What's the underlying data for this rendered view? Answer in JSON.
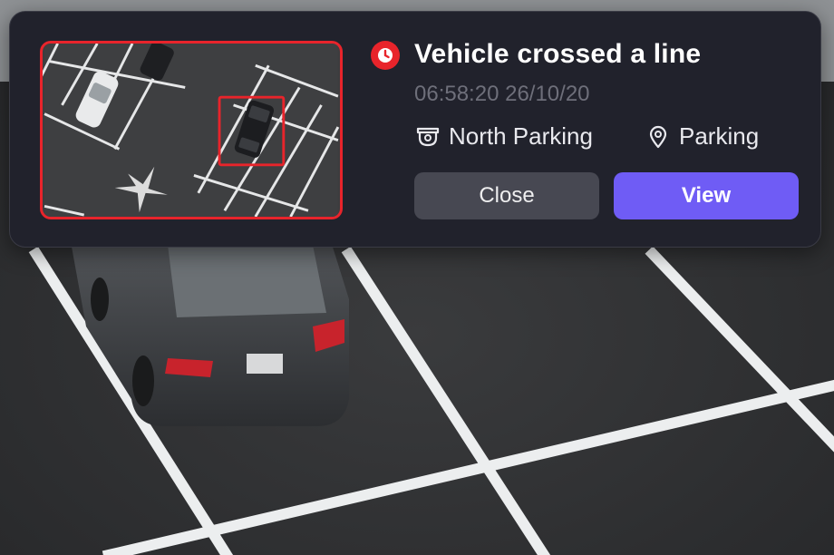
{
  "notification": {
    "event_icon": "alert-clock-icon",
    "title": "Vehicle crossed a line",
    "timestamp": "06:58:20 26/10/20",
    "camera": {
      "icon": "camera-icon",
      "name": "North Parking"
    },
    "location": {
      "icon": "location-pin-icon",
      "name": "Parking"
    },
    "close_label": "Close",
    "view_label": "View"
  },
  "colors": {
    "alert": "#e8242b",
    "accent": "#6f5cf5",
    "card_bg": "#21222c",
    "secondary_button": "#474852"
  }
}
